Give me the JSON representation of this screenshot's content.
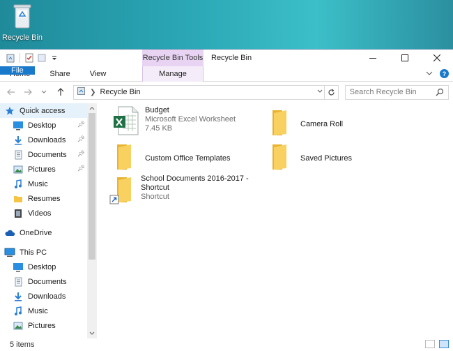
{
  "desktop": {
    "recycle_bin_label": "Recycle Bin"
  },
  "window": {
    "title": "Recycle Bin",
    "contextual_tab_group": "Recycle Bin Tools",
    "ribbon_tabs": {
      "file": "File",
      "home": "Home",
      "share": "Share",
      "view": "View",
      "manage": "Manage"
    },
    "address": {
      "crumb": "Recycle Bin"
    },
    "search": {
      "placeholder": "Search Recycle Bin"
    }
  },
  "nav": {
    "quick_access": "Quick access",
    "quick_items": [
      {
        "label": "Desktop",
        "icon": "desktop-icon",
        "pinned": true
      },
      {
        "label": "Downloads",
        "icon": "downloads-icon",
        "pinned": true
      },
      {
        "label": "Documents",
        "icon": "documents-icon",
        "pinned": true
      },
      {
        "label": "Pictures",
        "icon": "pictures-icon",
        "pinned": true
      },
      {
        "label": "Music",
        "icon": "music-icon",
        "pinned": false
      },
      {
        "label": "Resumes",
        "icon": "folder-icon",
        "pinned": false
      },
      {
        "label": "Videos",
        "icon": "videos-icon",
        "pinned": false
      }
    ],
    "onedrive": "OneDrive",
    "this_pc": "This PC",
    "pc_items": [
      {
        "label": "Desktop",
        "icon": "desktop-icon"
      },
      {
        "label": "Documents",
        "icon": "documents-icon"
      },
      {
        "label": "Downloads",
        "icon": "downloads-icon"
      },
      {
        "label": "Music",
        "icon": "music-icon"
      },
      {
        "label": "Pictures",
        "icon": "pictures-icon"
      }
    ]
  },
  "files": [
    {
      "name": "Budget",
      "type": "Microsoft Excel Worksheet",
      "size": "7.45 KB",
      "icon": "excel-icon"
    },
    {
      "name": "Camera Roll",
      "icon": "folder-icon"
    },
    {
      "name": "Custom Office Templates",
      "icon": "folder-icon"
    },
    {
      "name": "Saved Pictures",
      "icon": "folder-icon"
    },
    {
      "name_line1": "School Documents 2016-2017 -",
      "name_line2": "Shortcut",
      "type": "Shortcut",
      "icon": "folder-shortcut-icon"
    }
  ],
  "status": {
    "count": "5 items"
  },
  "colors": {
    "accent": "#1979ca",
    "contextual_tab": "#e8d3f3",
    "folder": "#f5c543",
    "excel_green": "#1e7145"
  }
}
